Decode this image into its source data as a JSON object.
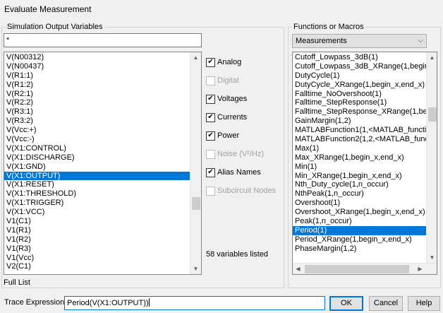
{
  "window": {
    "title": "Evaluate Measurement"
  },
  "left_panel": {
    "group_label": "Simulation Output Variables",
    "filter_value": "*",
    "variables": [
      "V(N00312)",
      "V(N00437)",
      "V(R1:1)",
      "V(R1:2)",
      "V(R2:1)",
      "V(R2:2)",
      "V(R3:1)",
      "V(R3:2)",
      "V(Vcc:+)",
      "V(Vcc:-)",
      "V(X1:CONTROL)",
      "V(X1:DISCHARGE)",
      "V(X1:GND)",
      "V(X1:OUTPUT)",
      "V(X1:RESET)",
      "V(X1:THRESHOLD)",
      "V(X1:TRIGGER)",
      "V(X1:VCC)",
      "V1(C1)",
      "V1(R1)",
      "V1(R2)",
      "V1(R3)",
      "V1(Vcc)",
      "V2(C1)"
    ],
    "selected_variable": "V(X1:OUTPUT)",
    "filters": [
      {
        "label": "Analog",
        "checked": true,
        "enabled": true
      },
      {
        "label": "Digital",
        "checked": false,
        "enabled": false
      },
      {
        "label": "Voltages",
        "checked": true,
        "enabled": true
      },
      {
        "label": "Currents",
        "checked": true,
        "enabled": true
      },
      {
        "label": "Power",
        "checked": true,
        "enabled": true
      },
      {
        "label": "Noise (V²/Hz)",
        "checked": false,
        "enabled": false
      },
      {
        "label": "Alias Names",
        "checked": true,
        "enabled": true
      },
      {
        "label": "Subcircuit Nodes",
        "checked": false,
        "enabled": false
      }
    ],
    "count_text": "58 variables listed",
    "footer_text": "Full List"
  },
  "right_panel": {
    "group_label": "Functions or Macros",
    "dropdown_value": "Measurements",
    "functions": [
      "Cutoff_Lowpass_3dB(1)",
      "Cutoff_Lowpass_3dB_XRange(1,begin_",
      "DutyCycle(1)",
      "DutyCycle_XRange(1,begin_x,end_x)",
      "Falltime_NoOvershoot(1)",
      "Falltime_StepResponse(1)",
      "Falltime_StepResponse_XRange(1,beg",
      "GainMargin(1,2)",
      "MATLABFunction1(1,<MATLAB_functio",
      "MATLABFunction2(1,2,<MATLAB_func",
      "Max(1)",
      "Max_XRange(1,begin_x,end_x)",
      "Min(1)",
      "Min_XRange(1,begin_x,end_x)",
      "Nth_Duty_cycle(1,n_occur)",
      "NthPeak(1,n_occur)",
      "Overshoot(1)",
      "Overshoot_XRange(1,begin_x,end_x)",
      "Peak(1,n_occur)",
      "Period(1)",
      "Period_XRange(1,begin_x,end_x)",
      "PhaseMargin(1,2)"
    ],
    "selected_function": "Period(1)"
  },
  "bottom": {
    "trace_label": "Trace Expression:",
    "trace_value": "Period(V(X1:OUTPUT))",
    "ok_label": "OK",
    "cancel_label": "Cancel",
    "help_label": "Help"
  }
}
